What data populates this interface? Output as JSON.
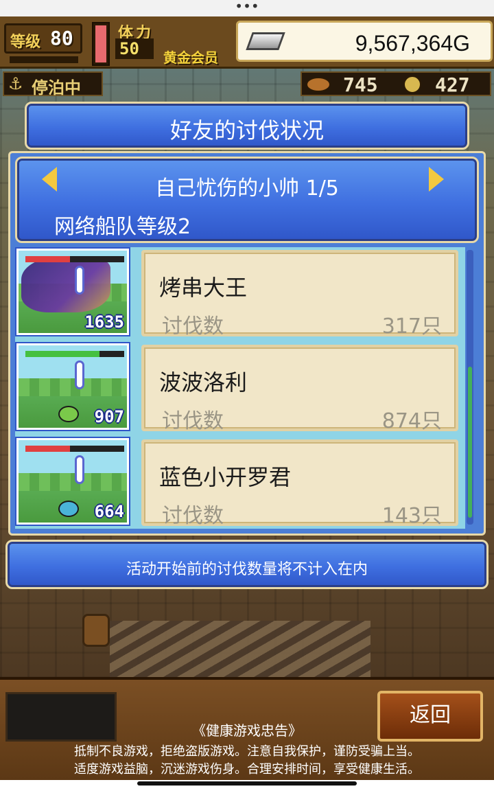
{
  "hud": {
    "level_label": "等级",
    "level_value": "80",
    "stamina_label": "体力",
    "stamina_value": "50",
    "member_label": "黄金会员",
    "money": "9,567,364G",
    "port_status": "停泊中",
    "resource_1": "745",
    "resource_2": "427"
  },
  "modal": {
    "title": "好友的讨伐状况",
    "friend_name": "自己忧伤的小帅 1/5",
    "fleet_level": "网络船队等级2",
    "notice": "活动开始前的讨伐数量将不计入在内"
  },
  "entries": [
    {
      "name": "烤串大王",
      "label": "讨伐数",
      "count": "317只",
      "monster_number": "1635",
      "hp_color": "#e04040"
    },
    {
      "name": "波波洛利",
      "label": "讨伐数",
      "count": "874只",
      "monster_number": "907",
      "hp_color": "#45c040"
    },
    {
      "name": "蓝色小开罗君",
      "label": "讨伐数",
      "count": "143只",
      "monster_number": "664",
      "hp_color": "#e04040"
    }
  ],
  "footer": {
    "back_label": "返回",
    "advisory_title": "《健康游戏忠告》",
    "advisory_line_1": "抵制不良游戏，拒绝盗版游戏。注意自我保护，谨防受骗上当。",
    "advisory_line_2": "适度游戏益脑，沉迷游戏伤身。合理安排时间，享受健康生活。"
  },
  "colors": {
    "panel_blue": "#3f6fe0",
    "card_bg": "#f1e6c8",
    "accent_gold": "#f3c93f"
  }
}
